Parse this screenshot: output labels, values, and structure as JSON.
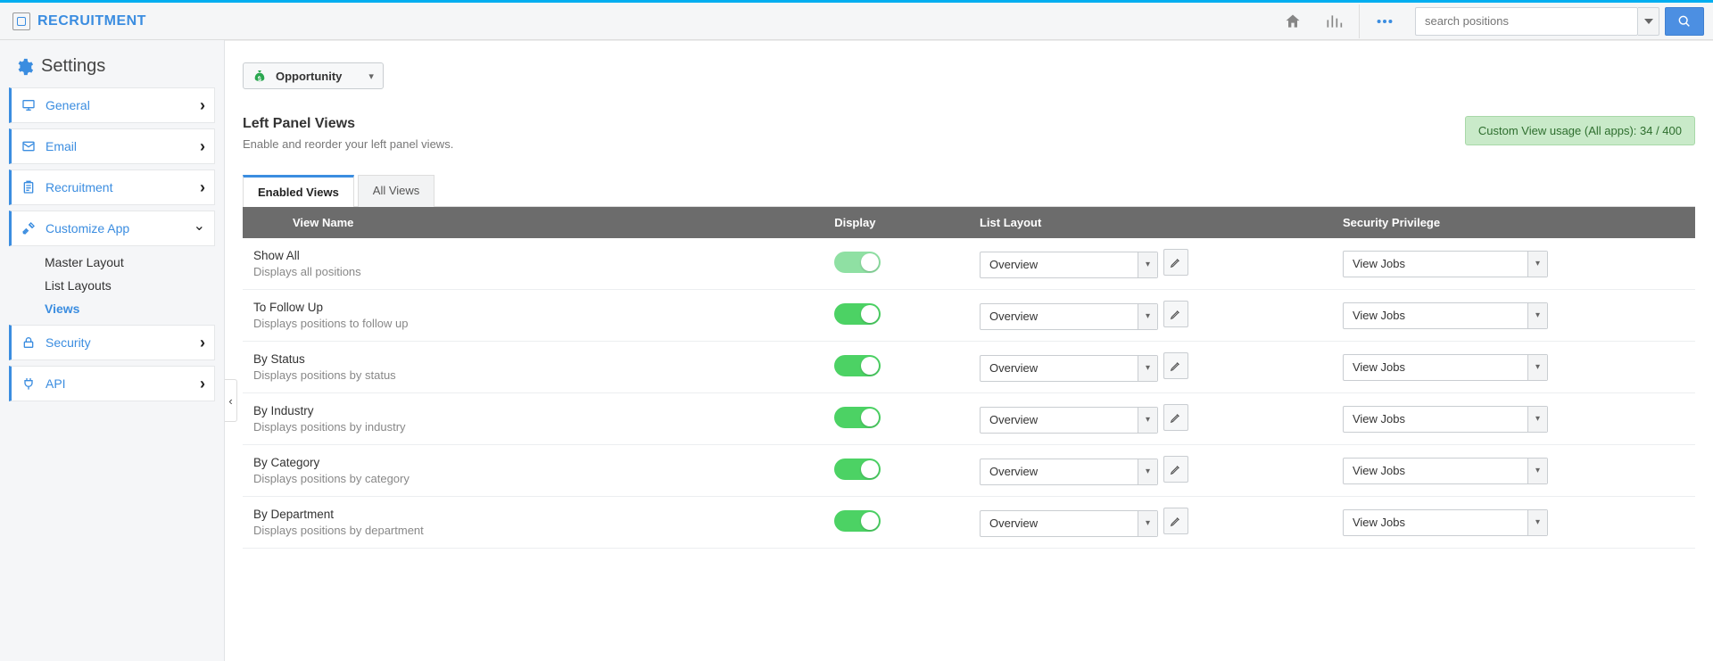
{
  "brand": {
    "title": "RECRUITMENT"
  },
  "search": {
    "placeholder": "search positions"
  },
  "sidebar": {
    "title": "Settings",
    "items": {
      "general": "General",
      "email": "Email",
      "recruitment": "Recruitment",
      "customize": "Customize App",
      "security": "Security",
      "api": "API"
    },
    "customize_children": {
      "master_layout": "Master Layout",
      "list_layouts": "List Layouts",
      "views": "Views"
    }
  },
  "entity": {
    "label": "Opportunity"
  },
  "section": {
    "title": "Left Panel Views",
    "subtitle": "Enable and reorder your left panel views."
  },
  "usage_badge": "Custom View usage (All apps): 34 / 400",
  "tabs": {
    "enabled": "Enabled Views",
    "all": "All Views"
  },
  "table": {
    "headers": {
      "name": "View Name",
      "display": "Display",
      "layout": "List Layout",
      "security": "Security Privilege"
    },
    "layout_value": "Overview",
    "security_value": "View Jobs",
    "rows": [
      {
        "name": "Show All",
        "desc": "Displays all positions",
        "soft": true
      },
      {
        "name": "To Follow Up",
        "desc": "Displays positions to follow up",
        "soft": false
      },
      {
        "name": "By Status",
        "desc": "Displays positions by status",
        "soft": false
      },
      {
        "name": "By Industry",
        "desc": "Displays positions by industry",
        "soft": false
      },
      {
        "name": "By Category",
        "desc": "Displays positions by category",
        "soft": false
      },
      {
        "name": "By Department",
        "desc": "Displays positions by department",
        "soft": false
      }
    ]
  }
}
